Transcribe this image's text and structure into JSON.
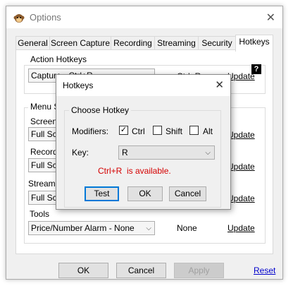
{
  "window": {
    "title": "Options",
    "icon": "monkey-app-icon"
  },
  "tabs": [
    {
      "label": "General"
    },
    {
      "label": "Screen Capture"
    },
    {
      "label": "Recording"
    },
    {
      "label": "Streaming"
    },
    {
      "label": "Security"
    },
    {
      "label": "Hotkeys",
      "active": true
    }
  ],
  "action_hotkeys": {
    "group_label": "Action Hotkeys",
    "help_badge": "?",
    "capture": {
      "combo": "Capture - Ctrl+R",
      "value": "Ctrl+R",
      "update": "Update"
    }
  },
  "menu_section": {
    "group_label": "Menu S",
    "rows": [
      {
        "label": "Screen",
        "combo": "Full Scr",
        "update": "Update"
      },
      {
        "label": "Record",
        "combo": "Full Scr",
        "update": "Update"
      },
      {
        "label": "Stream",
        "combo": "Full Scr",
        "update": "Update"
      }
    ],
    "tools": {
      "label": "Tools",
      "combo": "Price/Number Alarm - None",
      "value": "None",
      "update": "Update"
    }
  },
  "buttons": {
    "ok": "OK",
    "cancel": "Cancel",
    "apply": "Apply",
    "reset": "Reset"
  },
  "hotkeys_dialog": {
    "title": "Hotkeys",
    "group_label": "Choose Hotkey",
    "modifiers_label": "Modifiers:",
    "modifiers": [
      {
        "label": "Ctrl",
        "checked": true
      },
      {
        "label": "Shift",
        "checked": false
      },
      {
        "label": "Alt",
        "checked": false
      }
    ],
    "key_label": "Key:",
    "key_value": "R",
    "status_combo": "Ctrl+R",
    "status_text": "is available.",
    "buttons": {
      "test": "Test",
      "ok": "OK",
      "cancel": "Cancel"
    },
    "status_color": "#d40000",
    "focus_color": "#0078d7"
  }
}
